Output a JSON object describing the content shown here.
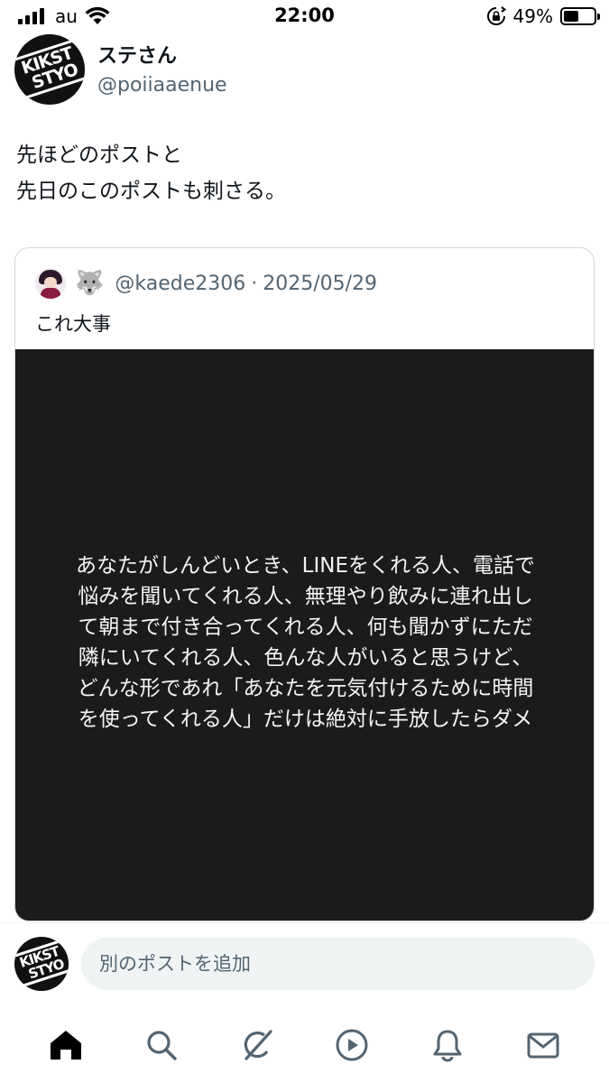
{
  "status_bar": {
    "carrier": "au",
    "time": "22:00",
    "battery_percent": "49%",
    "battery_level": 0.49,
    "icons": [
      "signal-icon",
      "wifi-icon",
      "rotation-lock-icon",
      "battery-icon"
    ]
  },
  "post": {
    "author": {
      "display_name": "ステさん",
      "handle": "@poiiaaenue",
      "avatar_text": [
        "KIKST",
        "STYO"
      ]
    },
    "text_lines": [
      "先ほどのポストと",
      "先日のこのポストも刺さる。"
    ],
    "quote": {
      "emoji": "🐺",
      "handle": "@kaede2306",
      "separator": "·",
      "date": "2025/05/29",
      "text": "これ大事",
      "image_text_lines": [
        "あなたがしんどいとき、LINEをくれる人、電話で",
        "悩みを聞いてくれる人、無理やり飲みに連れ出し",
        "て朝まで付き合ってくれる人、何も聞かずにただ",
        "隣にいてくれる人、色んな人がいると思うけど、",
        "どんな形であれ「あなたを元気付けるために時間",
        "を使ってくれる人」だけは絶対に手放したらダメ"
      ]
    }
  },
  "composer": {
    "placeholder": "別のポストを追加"
  },
  "tabbar": {
    "tabs": [
      "home-icon",
      "search-icon",
      "grok-icon",
      "video-icon",
      "notifications-icon",
      "messages-icon"
    ],
    "active": "home-icon",
    "colors": {
      "active": "#000000",
      "inactive": "#536471"
    }
  }
}
